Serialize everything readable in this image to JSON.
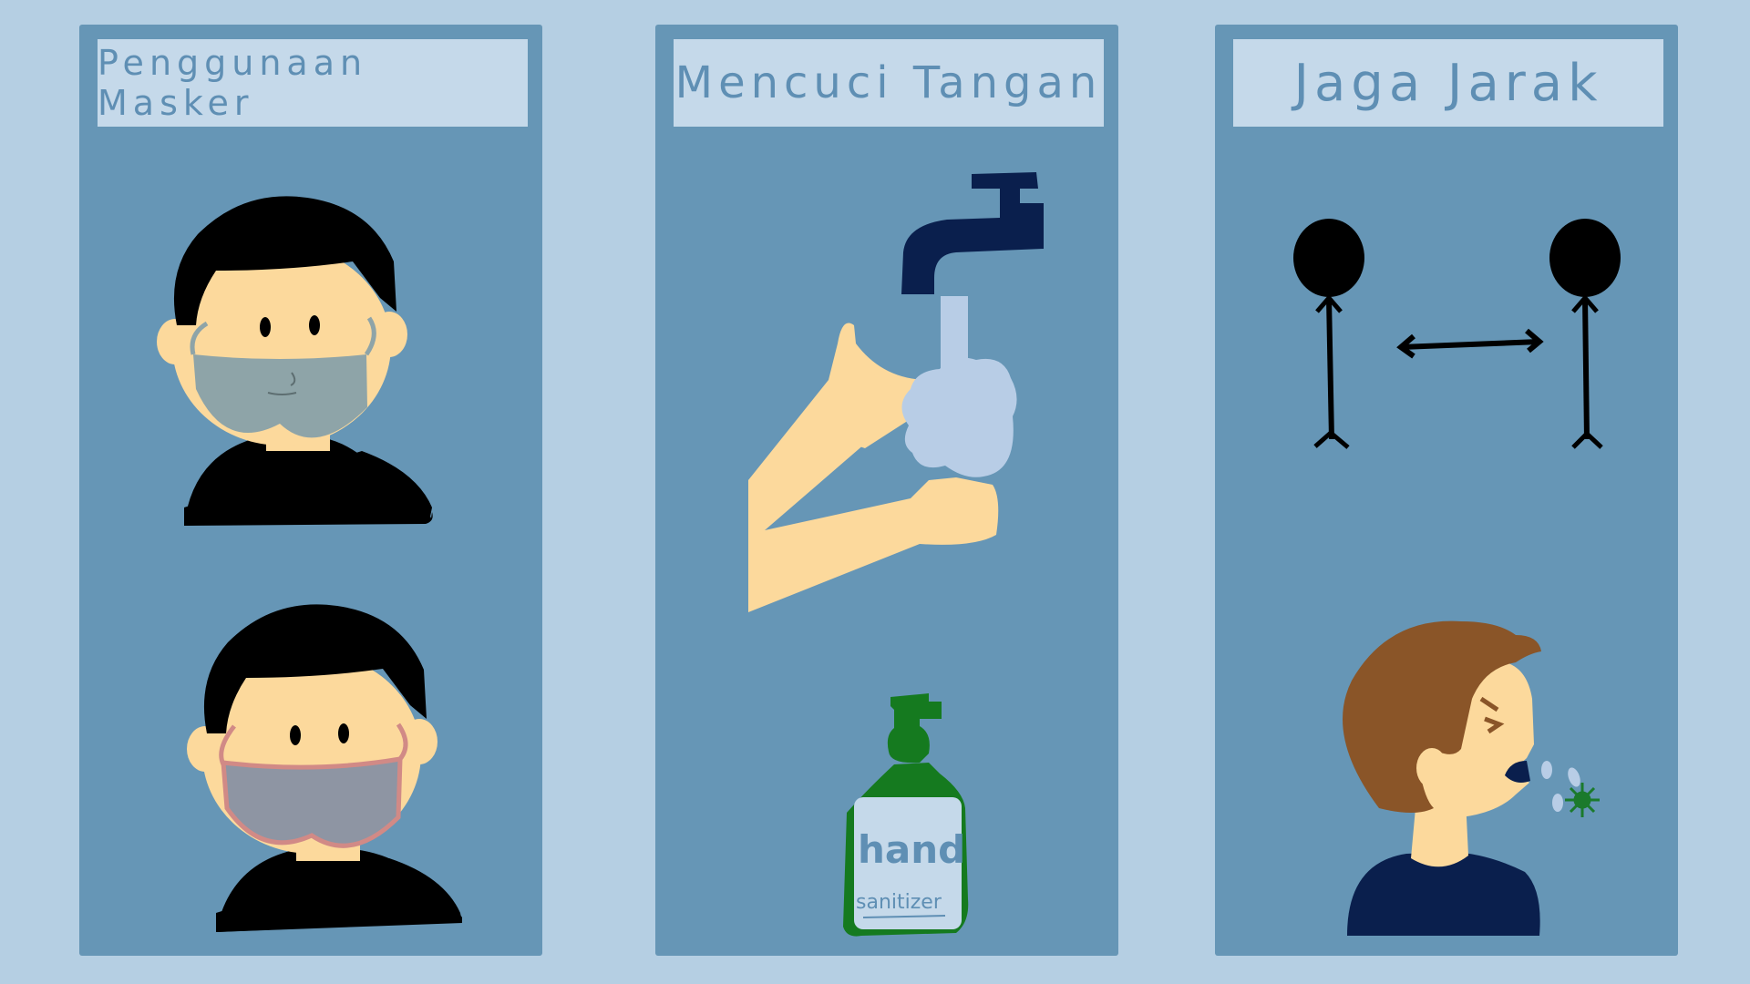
{
  "panels": [
    {
      "title": "Penggunaan Masker"
    },
    {
      "title": "Mencuci Tangan"
    },
    {
      "title": "Jaga Jarak"
    }
  ],
  "bottle": {
    "brand": "hand",
    "subtitle": "sanitizer"
  },
  "colors": {
    "background": "#b5cfe3",
    "panel": "#6696b6",
    "title_box": "#c5d9ea",
    "title_text": "#5f8fb4",
    "skin": "#fcd99c",
    "hair": "#000000",
    "mask_medical": "#8ea4a8",
    "mask_cloth": "#8e95a3",
    "faucet": "#0a1f4d",
    "water": "#b8cde6",
    "bottle_green": "#157a1f",
    "virus_green": "#1b7a2c",
    "person_hair_brown": "#8a5528",
    "shirt_navy": "#0a1f4d"
  }
}
